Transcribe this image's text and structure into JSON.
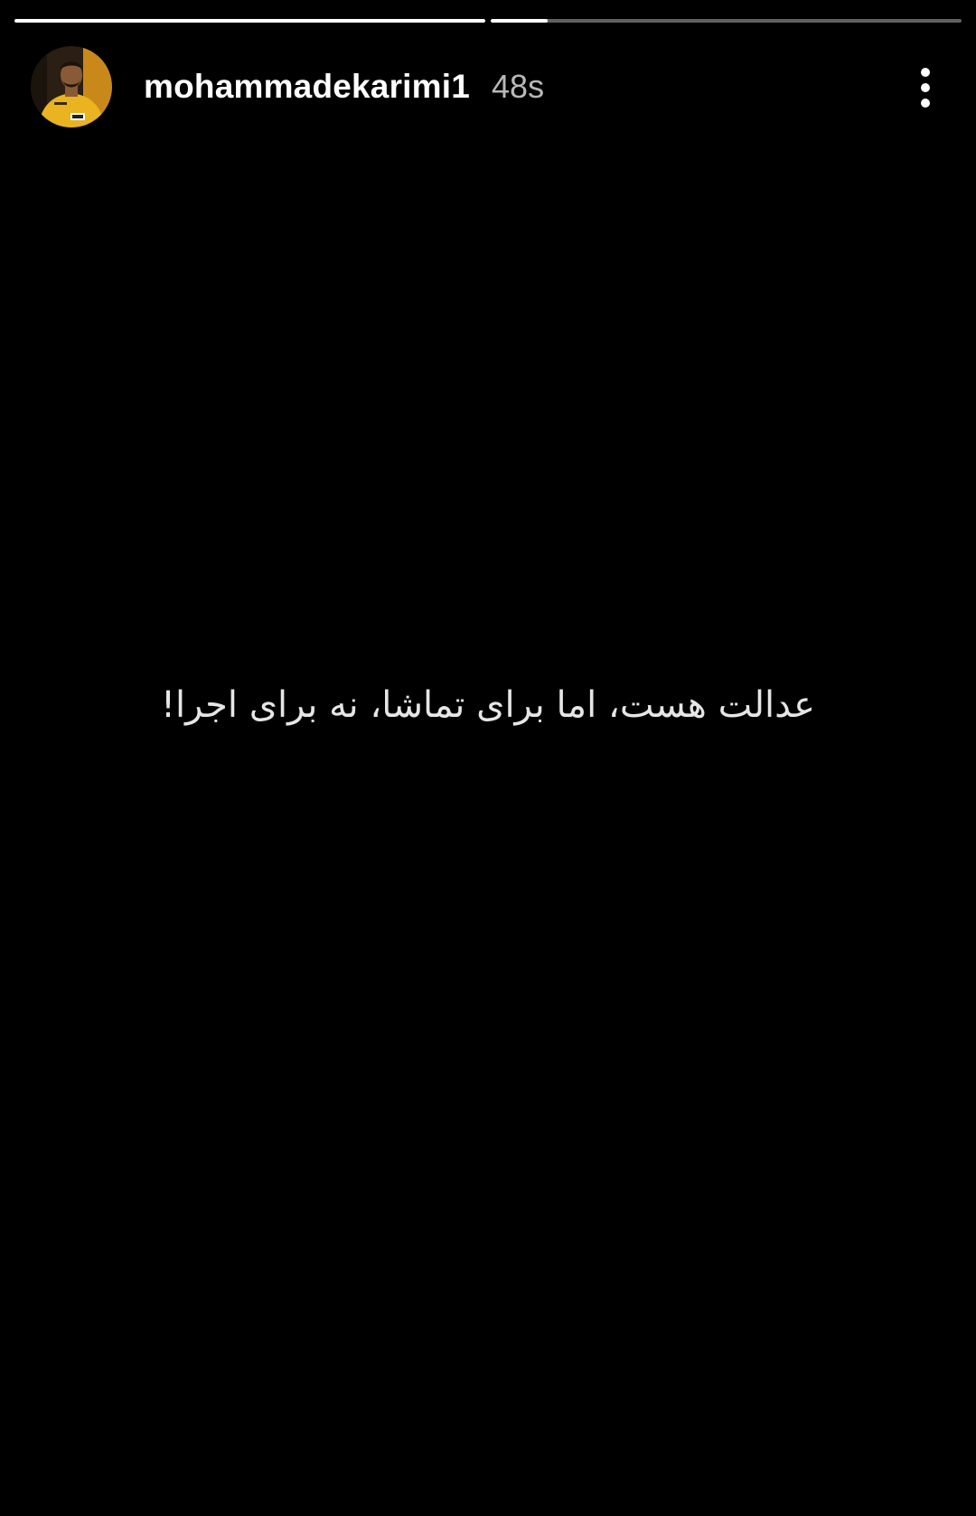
{
  "story": {
    "progress": [
      1.0,
      0.12
    ],
    "user": {
      "username": "mohammadekarimi1",
      "timestamp": "48s",
      "avatar_icon": "profile-photo-avatar"
    },
    "menu_icon": "more-vertical-icon",
    "caption": "عدالت هست، اما برای تماشا، نه برای اجرا!"
  },
  "colors": {
    "background": "#000000",
    "text": "#ffffff",
    "caption": "#e6e6e6",
    "avatar_shirt": "#e9b41f"
  }
}
